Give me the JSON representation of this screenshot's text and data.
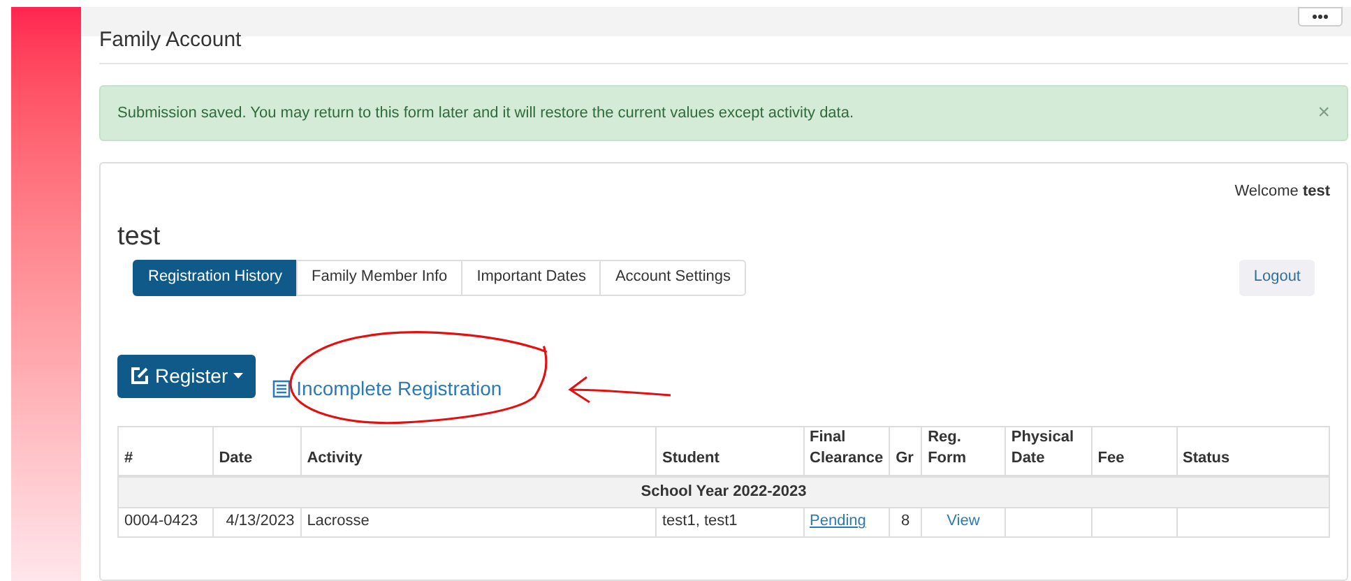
{
  "page_title": "Family Account",
  "alert": {
    "message": "Submission saved. You may return to this form later and it will restore the current values except activity data.",
    "close": "×"
  },
  "welcome": "Welcome **test**",
  "account_name": "test",
  "tabs": [
    {
      "label": "Registration History",
      "selected": true
    },
    {
      "label": "Family Member Info",
      "selected": false
    },
    {
      "label": "Important Dates",
      "selected": false
    },
    {
      "label": "Account Settings",
      "selected": false
    }
  ],
  "logout_button": "Logout",
  "register_button": "Register",
  "incomplete_link": "Incomplete Registration",
  "table": {
    "columns": [
      "#",
      "Date",
      "Activity",
      "Student",
      "Final Clearance",
      "Gr",
      "Reg. Form",
      "Physical Date",
      "Fee",
      "Status"
    ],
    "groups": [
      {
        "title": "School Year 2022-2023",
        "rows": [
          {
            "cells": [
              "0004-0423",
              "4/13/2023",
              "Lacrosse",
              "test1, test1",
              "Pending",
              "8",
              "View",
              "",
              "",
              ""
            ]
          }
        ]
      }
    ]
  }
}
